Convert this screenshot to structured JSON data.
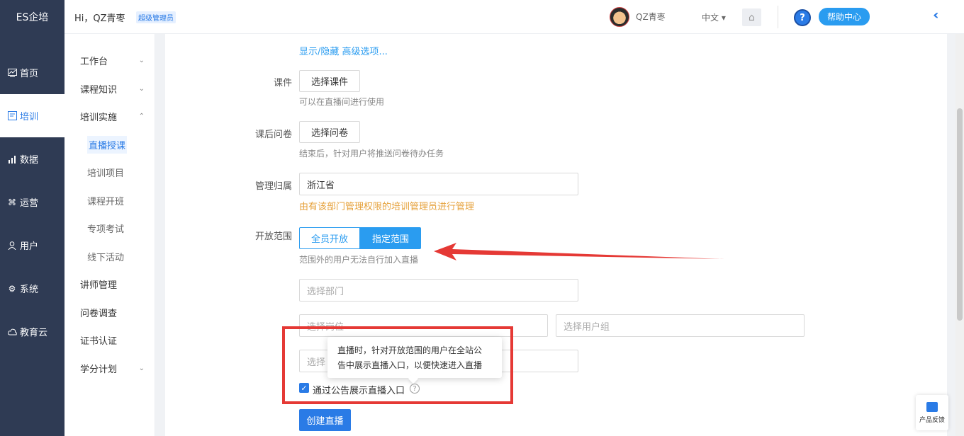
{
  "app": {
    "brand": "ES企培"
  },
  "topbar": {
    "greeting": "Hi，QZ青枣",
    "role_badge": "超级管理员",
    "username": "QZ青枣",
    "language": "中文 ▾",
    "help_label": "帮助中心"
  },
  "sidebar": {
    "items": [
      {
        "label": "首页",
        "icon": "chart-icon"
      },
      {
        "label": "培训",
        "icon": "book-icon"
      },
      {
        "label": "数据",
        "icon": "bar-chart-icon"
      },
      {
        "label": "运营",
        "icon": "cmd-icon"
      },
      {
        "label": "用户",
        "icon": "user-icon"
      },
      {
        "label": "系统",
        "icon": "gear-icon"
      },
      {
        "label": "教育云",
        "icon": "cloud-icon"
      }
    ]
  },
  "subnav": {
    "workbench": "工作台",
    "course_knowledge": "课程知识",
    "training_impl": "培训实施",
    "live": "直播授课",
    "project": "培训项目",
    "class": "课程开班",
    "exam": "专项考试",
    "offline": "线下活动",
    "lecturer": "讲师管理",
    "survey": "问卷调查",
    "cert": "证书认证",
    "credit": "学分计划"
  },
  "form": {
    "advanced_link": "显示/隐藏 高级选项...",
    "courseware_label": "课件",
    "courseware_btn": "选择课件",
    "courseware_hint": "可以在直播间进行使用",
    "survey_label": "课后问卷",
    "survey_btn": "选择问卷",
    "survey_hint": "结束后，针对用户将推送问卷待办任务",
    "owner_label": "管理归属",
    "owner_value": "浙江省",
    "owner_hint": "由有该部门管理权限的培训管理员进行管理",
    "scope_label": "开放范围",
    "scope_all": "全员开放",
    "scope_specified": "指定范围",
    "scope_hint": "范围外的用户无法自行加入直播",
    "dept_placeholder": "选择部门",
    "post_placeholder": "选择岗位",
    "group_placeholder": "选择用户组",
    "fourth_placeholder": "选择",
    "tooltip_line1": "直播时，针对开放范围的用户在全站公",
    "tooltip_line2": "告中展示直播入口，以便快速进入直播",
    "notice_checkbox": "通过公告展示直播入口",
    "submit": "创建直播"
  },
  "feedback": {
    "label": "产品反馈"
  },
  "colors": {
    "accent": "#2a7be6",
    "sidebar": "#2f3b54",
    "annotation": "#e53935",
    "warning_text": "#e6a23c"
  }
}
